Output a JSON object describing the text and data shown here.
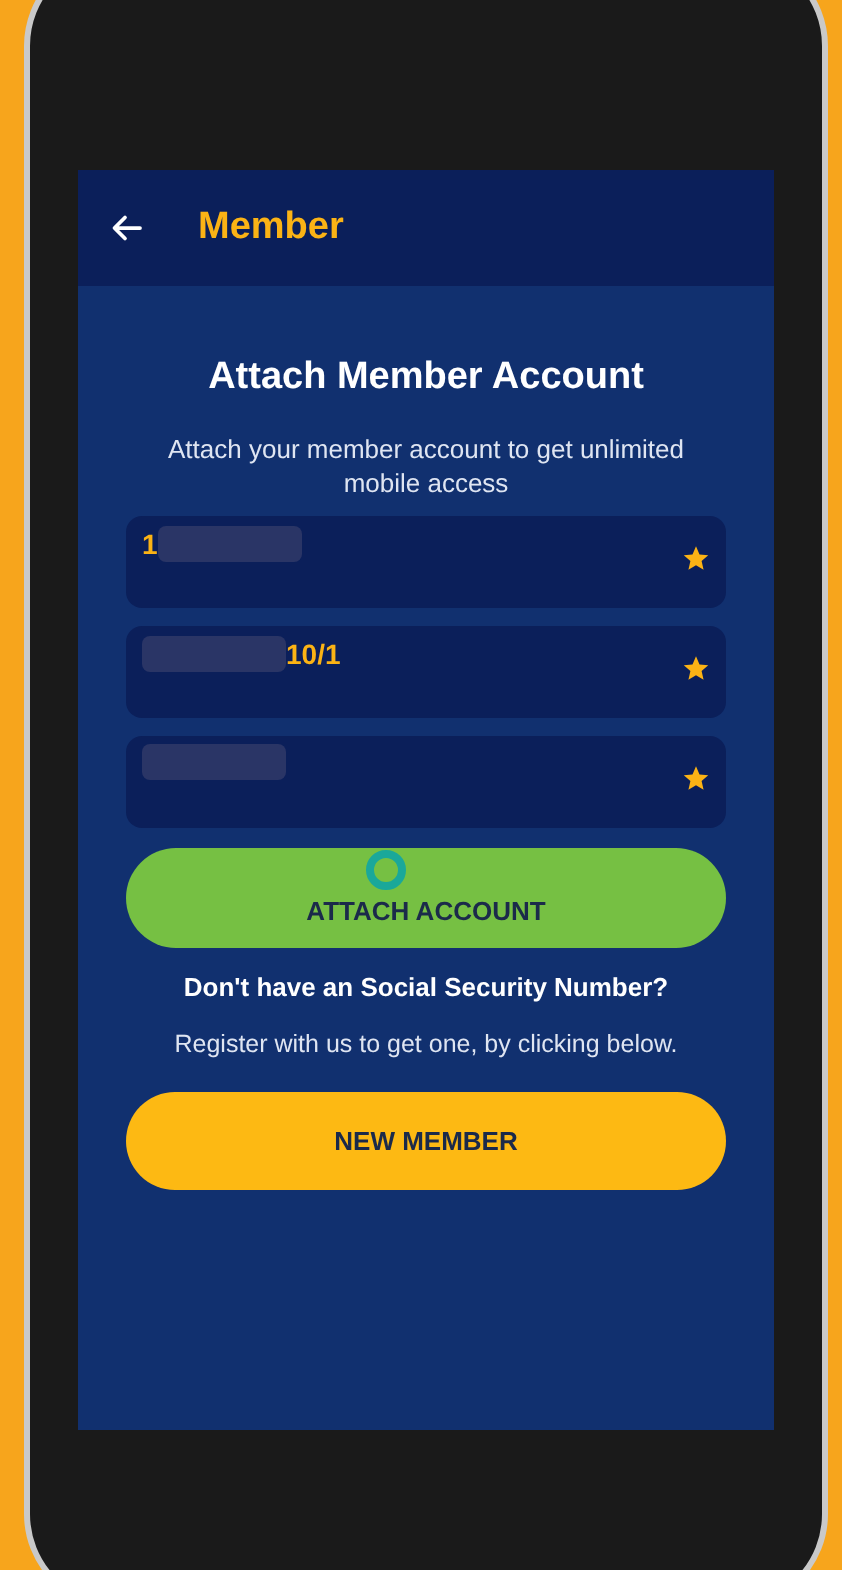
{
  "app_bar": {
    "title": "Member"
  },
  "heading": "Attach Member Account",
  "subtitle": "Attach your member account to get unlimited mobile access",
  "fields": [
    {
      "kind": "tail",
      "value": "1"
    },
    {
      "kind": "head",
      "value": "10/1"
    },
    {
      "kind": "mask"
    }
  ],
  "attach_button": {
    "label": "ATTACH ACCOUNT",
    "touched": true
  },
  "question": "Don't have an Social Security Number?",
  "hint": "Register with us to get one, by clicking below.",
  "new_member_button": {
    "label": "NEW MEMBER"
  }
}
